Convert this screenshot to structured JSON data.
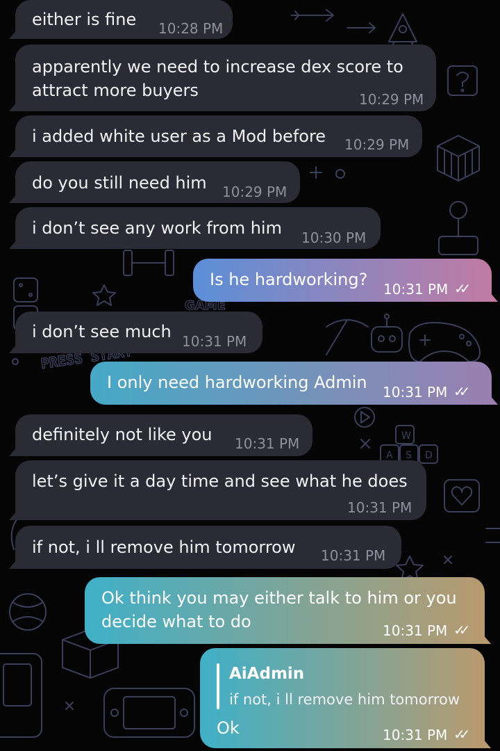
{
  "colors": {
    "background": "#050506",
    "incoming_bubble": "#2a2b34",
    "doodle_stroke": "#3b3f5a",
    "outgoing_gradient_1_start": "#5b8fd8",
    "outgoing_gradient_1_end": "#c07ba3",
    "outgoing_gradient_2_start": "#45a9c6",
    "outgoing_gradient_2_end": "#9a7fb0",
    "outgoing_gradient_3_start": "#3fb0c8",
    "outgoing_gradient_3_end": "#b89a6e"
  },
  "background_pattern": {
    "icons": [
      "rocket-icon",
      "arrow-icon",
      "question-block-icon",
      "rubiks-cube-icon",
      "joystick-icon",
      "game-controller-icon",
      "pickaxe-icon",
      "robot-icon",
      "dumbbell-icon",
      "dice-icon",
      "press-start-text-icon",
      "keyboard-keys-icon",
      "heart-icon",
      "star-icon",
      "handheld-console-icon",
      "box-icon",
      "tennis-ball-icon",
      "play-button-icon"
    ],
    "press_start": "PRESS START",
    "game_label": "GAME",
    "keys": [
      "W",
      "A",
      "S",
      "D"
    ]
  },
  "messages": [
    {
      "direction": "in",
      "lines": [
        "either is fine"
      ],
      "time": "10:28 PM"
    },
    {
      "direction": "in",
      "lines": [
        "apparently we need to increase dex score to",
        "attract more buyers"
      ],
      "time": "10:29 PM"
    },
    {
      "direction": "in",
      "lines": [
        "i added white user as a Mod before"
      ],
      "time": "10:29 PM"
    },
    {
      "direction": "in",
      "lines": [
        "do you still need him"
      ],
      "time": "10:29 PM"
    },
    {
      "direction": "in",
      "lines": [
        "i don’t see any work from him"
      ],
      "time": "10:30 PM"
    },
    {
      "direction": "out",
      "lines": [
        "Is he hardworking?"
      ],
      "time": "10:31 PM",
      "status": "read-double-check"
    },
    {
      "direction": "in",
      "lines": [
        "i don’t see much"
      ],
      "time": "10:31 PM"
    },
    {
      "direction": "out",
      "lines": [
        "I only need hardworking Admin"
      ],
      "time": "10:31 PM",
      "status": "read-double-check"
    },
    {
      "direction": "in",
      "lines": [
        "definitely not like you"
      ],
      "time": "10:31 PM"
    },
    {
      "direction": "in",
      "lines": [
        "let’s give it a day time and see what he does"
      ],
      "time": "10:31 PM"
    },
    {
      "direction": "in",
      "lines": [
        "if not, i ll remove him tomorrow"
      ],
      "time": "10:31 PM"
    },
    {
      "direction": "out",
      "lines": [
        "Ok think you may either talk to him or you",
        "decide what to do"
      ],
      "time": "10:31 PM",
      "status": "read-double-check"
    },
    {
      "direction": "out",
      "reply_to": {
        "name": "AiAdmin",
        "text": "if not, i ll remove him tomorrow"
      },
      "lines": [
        "Ok"
      ],
      "time": "10:31 PM",
      "status": "read-double-check"
    }
  ],
  "ticks_glyph": "✓✓"
}
